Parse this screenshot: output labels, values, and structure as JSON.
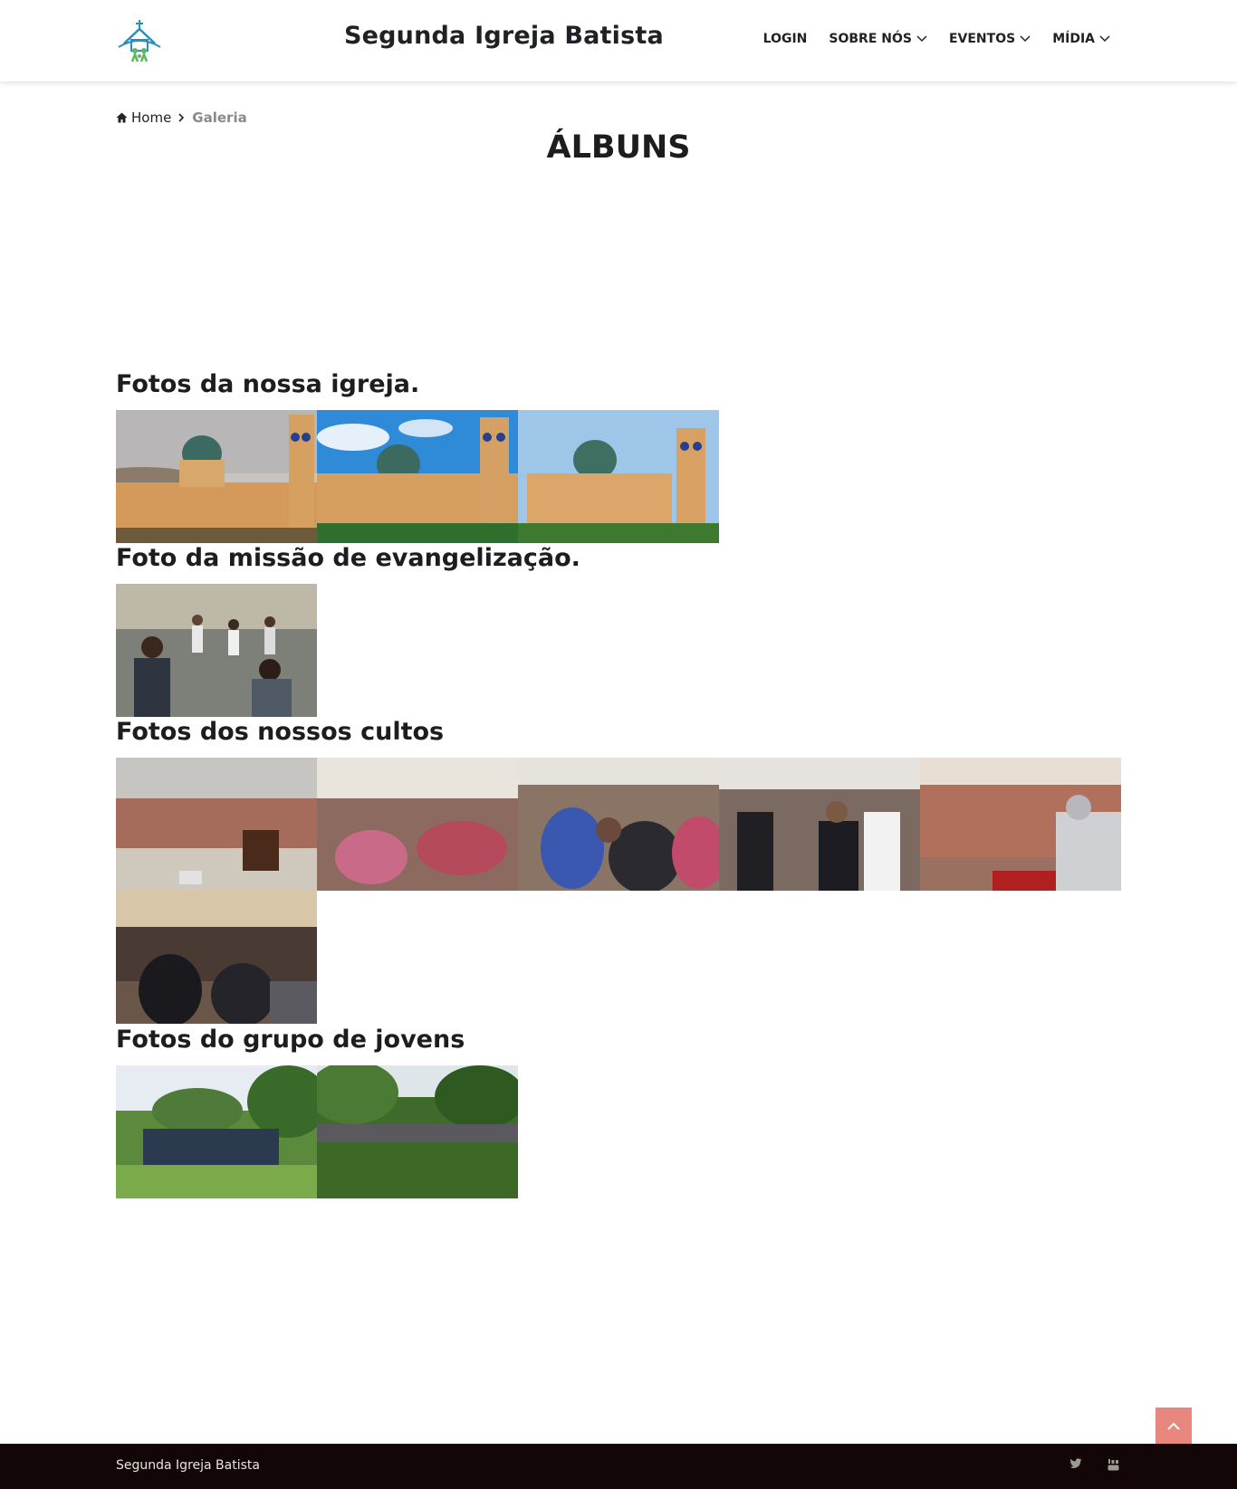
{
  "header": {
    "site_title": "Segunda Igreja Batista",
    "nav": [
      {
        "label": "LOGIN",
        "dropdown": false
      },
      {
        "label": "SOBRE NÓS",
        "dropdown": true
      },
      {
        "label": "EVENTOS",
        "dropdown": true
      },
      {
        "label": "MÍDIA",
        "dropdown": true
      }
    ]
  },
  "breadcrumb": {
    "home": "Home",
    "current": "Galeria"
  },
  "page_title": "ÁLBUNS",
  "albums": [
    {
      "title": "Fotos da nossa igreja."
    },
    {
      "title": "Foto da missão de evangelização."
    },
    {
      "title": "Fotos dos nossos cultos"
    },
    {
      "title": "Fotos do grupo de jovens"
    }
  ],
  "footer": {
    "text": "Segunda Igreja Batista"
  },
  "colors": {
    "accent": "#e8877d",
    "footer_bg": "#120606",
    "logo_blue": "#2a8fbd",
    "logo_green": "#5cb85c"
  }
}
